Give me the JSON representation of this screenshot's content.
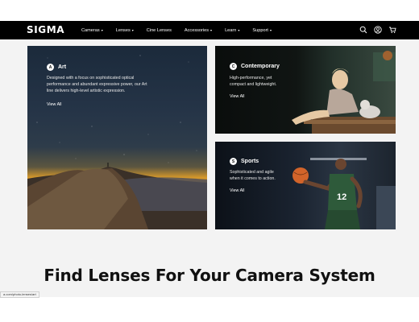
{
  "header": {
    "logo": "SIGMA",
    "nav": [
      {
        "label": "Cameras",
        "has_dropdown": true
      },
      {
        "label": "Lenses",
        "has_dropdown": true
      },
      {
        "label": "Cine Lenses",
        "has_dropdown": false
      },
      {
        "label": "Accessories",
        "has_dropdown": true
      },
      {
        "label": "Learn",
        "has_dropdown": true
      },
      {
        "label": "Support",
        "has_dropdown": true
      }
    ],
    "icons": [
      "search-icon",
      "user-icon",
      "cart-icon"
    ],
    "caret": "▾"
  },
  "cards": {
    "art": {
      "badge": "A",
      "title": "Art",
      "description_line1": "Designed with a focus on sophisticated optical",
      "description_line2": "performance and abundant expressive power, our Art",
      "description_line3": "line delivers high-level artistic expression.",
      "link": "View All"
    },
    "contemporary": {
      "badge": "C",
      "title": "Contemporary",
      "description_line1": "High-performance, yet",
      "description_line2": "compact and lightweight.",
      "link": "View All"
    },
    "sports": {
      "badge": "S",
      "title": "Sports",
      "description_line1": "Sophisticated and agile",
      "description_line2": "when it comes to action.",
      "link": "View All"
    }
  },
  "main": {
    "heading": "Find Lenses For Your Camera System"
  },
  "status_bar": {
    "url": "a.com/photo-lenses/art"
  },
  "colors": {
    "header_bg": "#000000",
    "section_bg": "#f3f3f3",
    "text_dark": "#111111"
  }
}
